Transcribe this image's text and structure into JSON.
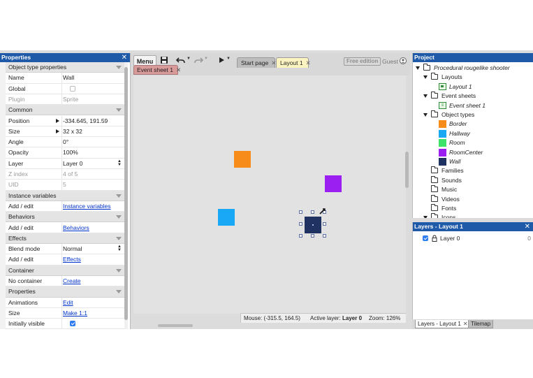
{
  "properties": {
    "title": "Properties",
    "rows": [
      {
        "kind": "cat",
        "name": "Object type properties"
      },
      {
        "kind": "prop",
        "name": "Name",
        "value": "Wall"
      },
      {
        "kind": "check",
        "name": "Global",
        "checked": false
      },
      {
        "kind": "prop",
        "name": "Plugin",
        "value": "Sprite",
        "dim": true
      },
      {
        "kind": "cat",
        "name": "Common"
      },
      {
        "kind": "expand",
        "name": "Position",
        "value": "-334.645, 191.59"
      },
      {
        "kind": "expand",
        "name": "Size",
        "value": "32 x 32"
      },
      {
        "kind": "prop",
        "name": "Angle",
        "value": "0°"
      },
      {
        "kind": "prop",
        "name": "Opacity",
        "value": "100%"
      },
      {
        "kind": "select",
        "name": "Layer",
        "value": "Layer 0"
      },
      {
        "kind": "prop",
        "name": "Z index",
        "value": "4 of 5",
        "dim": true
      },
      {
        "kind": "prop",
        "name": "UID",
        "value": "5",
        "dim": true
      },
      {
        "kind": "cat",
        "name": "Instance variables"
      },
      {
        "kind": "link",
        "name": "Add / edit",
        "value": "Instance variables"
      },
      {
        "kind": "cat",
        "name": "Behaviors"
      },
      {
        "kind": "link",
        "name": "Add / edit",
        "value": "Behaviors"
      },
      {
        "kind": "cat",
        "name": "Effects"
      },
      {
        "kind": "select",
        "name": "Blend mode",
        "value": "Normal"
      },
      {
        "kind": "link",
        "name": "Add / edit",
        "value": "Effects"
      },
      {
        "kind": "cat",
        "name": "Container"
      },
      {
        "kind": "link",
        "name": "No container",
        "value": "Create"
      },
      {
        "kind": "cat",
        "name": "Properties"
      },
      {
        "kind": "link",
        "name": "Animations",
        "value": "Edit"
      },
      {
        "kind": "link",
        "name": "Size",
        "value": "Make 1:1"
      },
      {
        "kind": "check",
        "name": "Initially visible",
        "checked": true
      }
    ]
  },
  "toolbar": {
    "menu_label": "Menu",
    "free_edition": "Free edition",
    "guest": "Guest"
  },
  "tabs": {
    "start_page": "Start page",
    "layout": "Layout 1",
    "event_sheet": "Event sheet 1"
  },
  "canvas": {
    "sprites": [
      {
        "name": "Border",
        "color": "#f78c1b"
      },
      {
        "name": "RoomCenter",
        "color": "#9b1ff0"
      },
      {
        "name": "Hallway",
        "color": "#18a8f5"
      },
      {
        "name": "Wall",
        "color": "#1f3262",
        "selected": true
      }
    ]
  },
  "status": {
    "mouse": "Mouse: (-315.5, 164.5)",
    "active_layer_label": "Active layer:",
    "active_layer": "Layer 0",
    "zoom": "Zoom: 126%"
  },
  "project": {
    "title": "Project",
    "root": "Procedural rougelike shooter",
    "layouts_label": "Layouts",
    "layout_item": "Layout 1",
    "event_sheets_label": "Event sheets",
    "event_sheet_item": "Event sheet 1",
    "object_types_label": "Object types",
    "objects": [
      {
        "name": "Border",
        "color": "#f78c1b"
      },
      {
        "name": "Hallway",
        "color": "#18a8f5"
      },
      {
        "name": "Room",
        "color": "#3ee36a"
      },
      {
        "name": "RoomCenter",
        "color": "#9b1ff0"
      },
      {
        "name": "Wall",
        "color": "#1f3262"
      }
    ],
    "folders": [
      "Families",
      "Sounds",
      "Music",
      "Videos",
      "Fonts"
    ],
    "cut_off": "Icons"
  },
  "layers": {
    "title": "Layers - Layout 1",
    "layer_name": "Layer 0",
    "layer_count": "0",
    "tab_layers": "Layers - Layout 1",
    "tab_tilemap": "Tilemap"
  }
}
